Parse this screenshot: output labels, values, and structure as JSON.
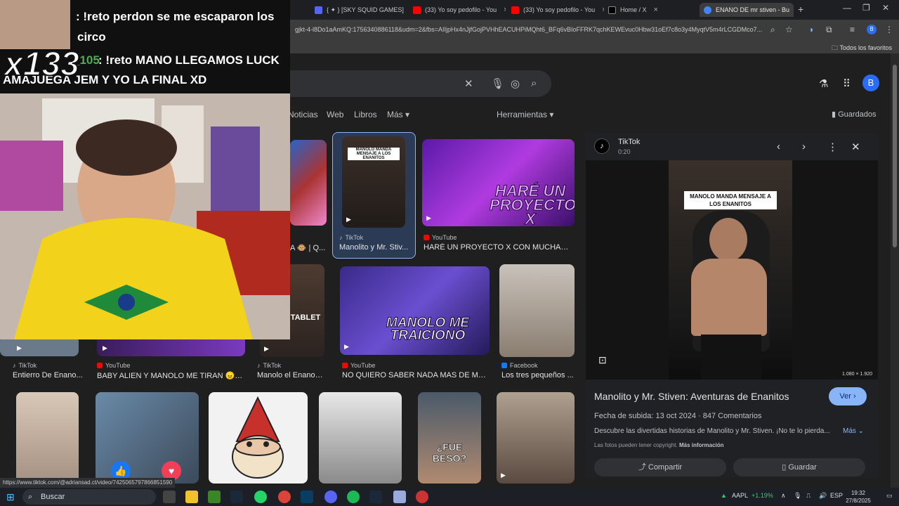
{
  "browser": {
    "tabs": [
      {
        "label": "{ ✦ } [SKY SQUID GAMES]",
        "favicon_color": "#5865f2",
        "active": false
      },
      {
        "label": "(33) Yo soy pedofilo - You",
        "favicon_color": "#ff0000",
        "active": false
      },
      {
        "label": "(33) Yo soy pedofilo - You",
        "favicon_color": "#ff0000",
        "active": false
      },
      {
        "label": "Home / X",
        "favicon_color": "#000000",
        "active": false
      },
      {
        "label": "ENANO DE mr stiven - Bu",
        "favicon_color": "#4285f4",
        "active": true
      }
    ],
    "url": "gjkt-4-l8Do1aAmKQ:1756340886118&udm=2&fbs=AIIjpHx4nJjfGojPVHhEACUHPiMQht6_BFq6vBIoFFRK7qchKEWEvuc0Hbw31oEf7c8o3y4MyqtV5m4rLCGDMco7...",
    "bookmarks_label": "Todos los favoritos",
    "status_url": "https://www.tiktok.com/@adriansad.ct/video/7425065797866851590"
  },
  "google": {
    "avatar_letter": "B",
    "nav_tabs": [
      "Noticias",
      "Web",
      "Libros",
      "Más ▾",
      "Herramientas ▾"
    ],
    "saved_label": "Guardados"
  },
  "results_row1": [
    {
      "source": "",
      "title": "A 🐵 | Q..."
    },
    {
      "source": "TikTok",
      "title": "Manolito y Mr. Stiv...",
      "overlay": "MANOLO MANDA MENSAJE A LOS ENANITOS"
    },
    {
      "source": "YouTube",
      "title": "HARÉ UN PROYECTO X CON MUCHAS ...",
      "overlay": "HARÉ UN PROYECTO X"
    }
  ],
  "results_row2": [
    {
      "source": "TikTok",
      "title": "Entierro De Enano..."
    },
    {
      "source": "YouTube",
      "title": "BABY ALIEN Y MANOLO ME TIRAN 😠 \"..."
    },
    {
      "source": "TikTok",
      "title": "Manolo el Enano: ...",
      "overlay": "TABLET"
    },
    {
      "source": "YouTube",
      "title": "NO QUIERO SABER NADA MAS DE MA...",
      "overlay": "MANOLO ME TRAICIONÓ"
    },
    {
      "source": "Facebook",
      "title": "Los tres pequeños ..."
    }
  ],
  "results_row3": [
    {
      "overlay": ""
    },
    {
      "overlay": ""
    },
    {
      "overlay": ""
    },
    {
      "overlay": ""
    },
    {
      "overlay": "¿FUE BESO?"
    },
    {
      "overlay": ""
    }
  ],
  "preview": {
    "source": "TikTok",
    "duration": "0:20",
    "image_caption": "MANOLO MANDA MENSAJE A LOS ENANITOS",
    "resolution": "1.080 × 1.920",
    "title": "Manolito y Mr. Stiven: Aventuras de Enanitos",
    "visit_label": "Ver",
    "meta": "Fecha de subida: 13 oct 2024 · 847 Comentarios",
    "description": "Descubre las divertidas historias de Manolito y Mr. Stiven. ¡No te lo pierda...",
    "more_label": "Más",
    "copyright": "Las fotos pueden tener copyright.",
    "copyright_link": "Más información",
    "share_label": "Compartir",
    "save_label": "Guardar"
  },
  "stream": {
    "chat_line1": ": !reto perdon se me escaparon los",
    "chat_line2": "circo",
    "chat_user": "_105",
    "chat_line3": ": !reto MANO LLEGAMOS LUCK",
    "chat_line4": "AMAJUEGA JEM Y YO LA FINAL XD",
    "counter": "x133"
  },
  "taskbar": {
    "search_label": "Buscar",
    "ticker": "AAPL",
    "ticker_change": "+1.19%",
    "lang": "ESP",
    "time": "19:32",
    "date": "27/8/2025"
  }
}
